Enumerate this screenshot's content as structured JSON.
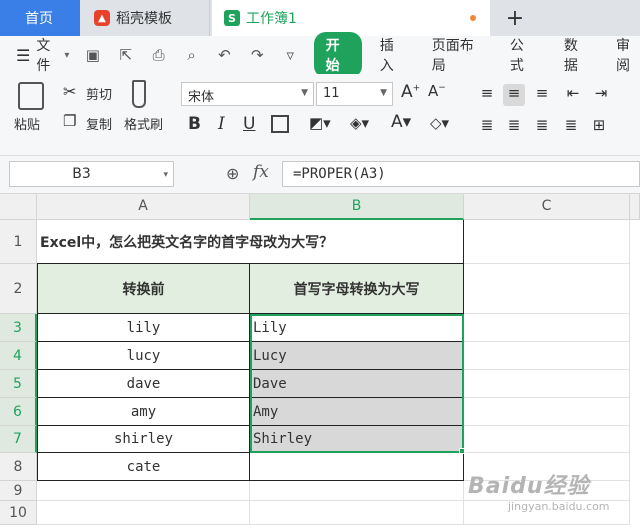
{
  "tabs": {
    "home": "首页",
    "docer": "稻壳模板",
    "workbook": "工作簿1",
    "add": "+"
  },
  "menu": {
    "file": "文件",
    "start": "开始",
    "insert": "插入",
    "layout": "页面布局",
    "formula": "公式",
    "data": "数据",
    "review": "审阅"
  },
  "ribbon": {
    "paste": "粘贴",
    "cut": "剪切",
    "copy": "复制",
    "format_painter": "格式刷",
    "font_name": "宋体",
    "font_size": "11",
    "bold": "B",
    "italic": "I",
    "underline": "U"
  },
  "formula_bar": {
    "cell_ref": "B3",
    "fx": "fx",
    "formula": "=PROPER(A3)"
  },
  "sheet": {
    "columns": [
      "A",
      "B",
      "C"
    ],
    "rows": [
      "1",
      "2",
      "3",
      "4",
      "5",
      "6",
      "7",
      "8",
      "9",
      "10"
    ],
    "title": "Excel中，怎么把英文名字的首字母改为大写？",
    "header_a": "转换前",
    "header_b": "首写字母转换为大写",
    "data_a": [
      "lily",
      "lucy",
      "dave",
      "amy",
      "shirley",
      "cate"
    ],
    "data_b": [
      "Lily",
      "Lucy",
      "Dave",
      "Amy",
      "Shirley",
      ""
    ]
  },
  "watermark": {
    "main": "Baidu经验",
    "sub": "jingyan.baidu.com"
  },
  "colors": {
    "accent_green": "#1fa35c",
    "home_tab_blue": "#3a7ee8",
    "header_fill": "#e2efe0"
  }
}
